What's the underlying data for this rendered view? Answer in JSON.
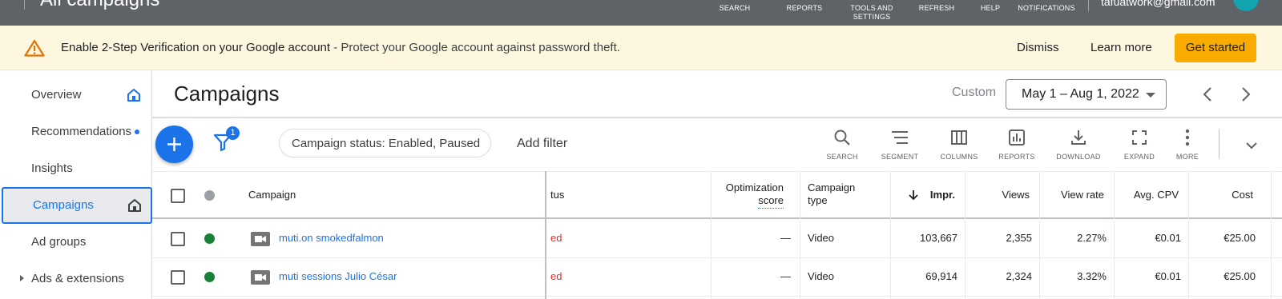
{
  "topbar": {
    "app_title": "All campaigns",
    "nav": [
      {
        "label": "SEARCH"
      },
      {
        "label": "REPORTS"
      },
      {
        "label": "TOOLS AND\nSETTINGS"
      },
      {
        "label": "REFRESH"
      },
      {
        "label": "HELP"
      },
      {
        "label": "NOTIFICATIONS"
      }
    ],
    "email": "tafuatwork@gmail.com"
  },
  "banner": {
    "title": "Enable 2-Step Verification on your Google account",
    "message": " - Protect your Google account against password theft.",
    "dismiss": "Dismiss",
    "learn_more": "Learn more",
    "get_started": "Get started"
  },
  "sidebar": {
    "items": [
      {
        "label": "Overview"
      },
      {
        "label": "Recommendations"
      },
      {
        "label": "Insights"
      },
      {
        "label": "Campaigns"
      },
      {
        "label": "Ad groups"
      },
      {
        "label": "Ads & extensions"
      }
    ]
  },
  "header": {
    "title": "Campaigns",
    "range_label": "Custom",
    "date_range": "May 1 – Aug 1, 2022"
  },
  "toolbar": {
    "filter_count": "1",
    "filter_chip": "Campaign status: Enabled, Paused",
    "add_filter": "Add filter",
    "tools": [
      {
        "label": "SEARCH",
        "icon": "search-icon"
      },
      {
        "label": "SEGMENT",
        "icon": "segment-icon"
      },
      {
        "label": "COLUMNS",
        "icon": "columns-icon"
      },
      {
        "label": "REPORTS",
        "icon": "reports-icon"
      },
      {
        "label": "DOWNLOAD",
        "icon": "download-icon"
      },
      {
        "label": "EXPAND",
        "icon": "expand-icon"
      },
      {
        "label": "MORE",
        "icon": "more-icon"
      }
    ]
  },
  "table": {
    "columns": {
      "campaign": "Campaign",
      "status": "tus",
      "opt_score_1": "Optimization",
      "opt_score_2": "score",
      "type_1": "Campaign",
      "type_2": "type",
      "impr": "Impr.",
      "views": "Views",
      "view_rate": "View rate",
      "avg_cpv": "Avg. CPV",
      "cost": "Cost"
    },
    "rows": [
      {
        "campaign": "muti.on smokedfalmon",
        "status": "ed",
        "opt_score": "—",
        "type": "Video",
        "impr": "103,667",
        "views": "2,355",
        "view_rate": "2.27%",
        "avg_cpv": "€0.01",
        "cost": "€25.00"
      },
      {
        "campaign": "muti sessions Julio César",
        "status": "ed",
        "opt_score": "—",
        "type": "Video",
        "impr": "69,914",
        "views": "2,324",
        "view_rate": "3.32%",
        "avg_cpv": "€0.01",
        "cost": "€25.00"
      }
    ]
  },
  "colors": {
    "accent": "#1a73e8",
    "banner_bg": "#fef7e0",
    "primary_button": "#f9ab00",
    "enabled_dot": "#188038",
    "header_dot": "#9aa0a6",
    "topbar": "#5f6368"
  }
}
